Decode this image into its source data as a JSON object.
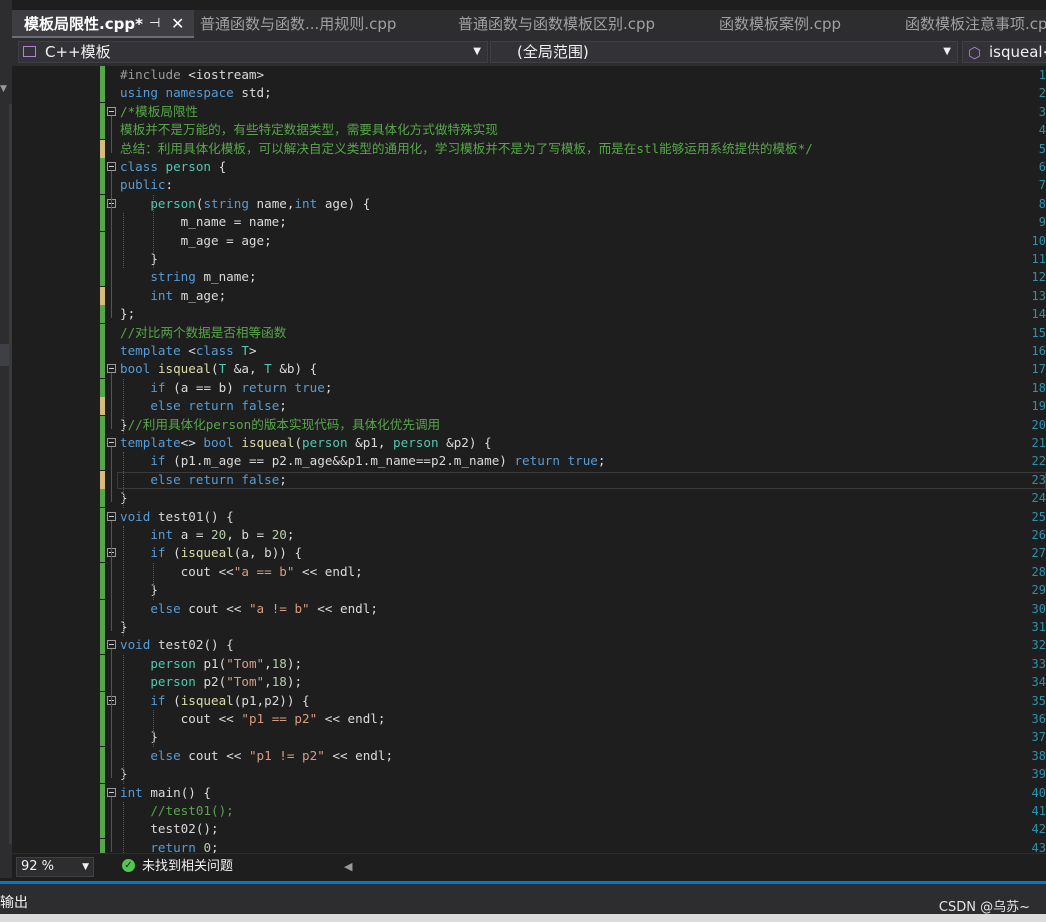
{
  "tabs": [
    {
      "label": "模板局限性.cpp*",
      "active": true
    },
    {
      "label": "普通函数与函数...用规则.cpp",
      "active": false
    },
    {
      "label": "普通函数与函数模板区别.cpp",
      "active": false
    },
    {
      "label": "函数模板案例.cpp",
      "active": false
    },
    {
      "label": "函数模板注意事项.cp",
      "active": false
    }
  ],
  "tab_pin_icon": "pin-icon",
  "tab_close_icon": "close-icon",
  "nav": {
    "project": "C++模板",
    "scope": "(全局范围)",
    "member": "isqueal<"
  },
  "editor": {
    "line_numbers": [
      "1",
      "2",
      "3",
      "4",
      "5",
      "6",
      "7",
      "8",
      "9",
      "10",
      "11",
      "12",
      "13",
      "14",
      "15",
      "16",
      "17",
      "18",
      "19",
      "20",
      "21",
      "22",
      "23",
      "24",
      "25",
      "26",
      "27",
      "28",
      "29",
      "30",
      "31",
      "32",
      "33",
      "34",
      "35",
      "36",
      "37",
      "38",
      "39",
      "40",
      "41",
      "42",
      "43"
    ],
    "lines": [
      "#include <iostream>",
      "using namespace std;",
      "/*模板局限性",
      "模板并不是万能的，有些特定数据类型，需要具体化方式做特殊实现",
      "总结：利用具体化模板，可以解决自定义类型的通用化，学习模板并不是为了写模板，而是在stl能够运用系统提供的模板*/",
      "class person {",
      "public:",
      "    person(string name,int age) {",
      "        m_name = name;",
      "        m_age = age;",
      "    }",
      "    string m_name;",
      "    int m_age;",
      "};",
      "//对比两个数据是否相等函数",
      "template <class T>",
      "bool isqueal(T &a, T &b) {",
      "    if (a == b) return true;",
      "    else return false;",
      "}//利用具体化person的版本实现代码，具体化优先调用",
      "template<> bool isqueal(person &p1, person &p2) {",
      "    if (p1.m_age == p2.m_age&&p1.m_name==p2.m_name) return true;",
      "    else return false;",
      "}",
      "void test01() {",
      "    int a = 20, b = 20;",
      "    if (isqueal(a, b)) {",
      "        cout <<\"a == b\" << endl;",
      "    }",
      "    else cout << \"a != b\" << endl;",
      "}",
      "void test02() {",
      "    person p1(\"Tom\",18);",
      "    person p2(\"Tom\",18);",
      "    if (isqueal(p1,p2)) {",
      "        cout << \"p1 == p2\" << endl;",
      "    }",
      "    else cout << \"p1 != p2\" << endl;",
      "}",
      "int main() {",
      "    //test01();",
      "    test02();",
      "    return 0;"
    ]
  },
  "status": {
    "zoom": "92 %",
    "issues": "未找到相关问题"
  },
  "output_panel": {
    "label": "输出"
  },
  "watermark": "CSDN @乌苏~",
  "colors": {
    "accent": "#007acc",
    "changed_saved": "#57a64a",
    "changed_unsaved": "#d7ba7d",
    "line_number": "#2b91af",
    "keyword": "#569cd6",
    "comment": "#57a64a",
    "type": "#4ec9b0",
    "string": "#d69d85"
  }
}
